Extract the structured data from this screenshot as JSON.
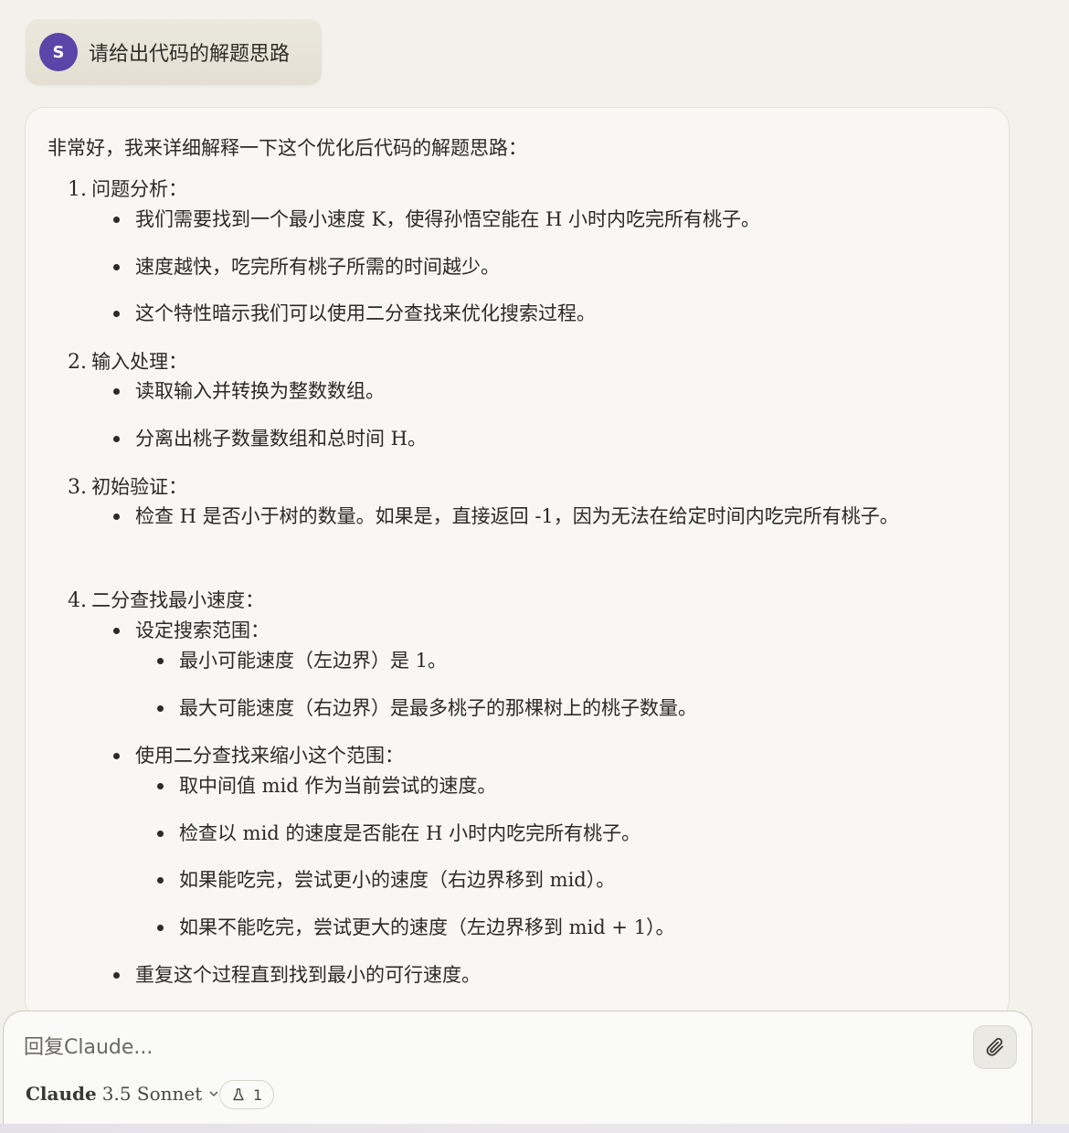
{
  "user_message": {
    "avatar_letter": "S",
    "text": "请给出代码的解题思路"
  },
  "assistant": {
    "intro": "非常好，我来详细解释一下这个优化后代码的解题思路：",
    "steps": [
      {
        "num": "1.",
        "title": "问题分析：",
        "bullets": [
          "我们需要找到一个最小速度 K，使得孙悟空能在 H 小时内吃完所有桃子。",
          "速度越快，吃完所有桃子所需的时间越少。",
          "这个特性暗示我们可以使用二分查找来优化搜索过程。"
        ]
      },
      {
        "num": "2.",
        "title": "输入处理：",
        "bullets": [
          "读取输入并转换为整数数组。",
          "分离出桃子数量数组和总时间 H。"
        ]
      },
      {
        "num": "3.",
        "title": "初始验证：",
        "bullets": [
          "检查 H 是否小于树的数量。如果是，直接返回 -1，因为无法在给定时间内吃完所有桃子。"
        ]
      },
      {
        "num": "4.",
        "title": "二分查找最小速度：",
        "bullets": [
          {
            "text": "设定搜索范围：",
            "sub": [
              "最小可能速度（左边界）是 1。",
              "最大可能速度（右边界）是最多桃子的那棵树上的桃子数量。"
            ]
          },
          {
            "text": "使用二分查找来缩小这个范围：",
            "sub": [
              "取中间值 mid 作为当前尝试的速度。",
              "检查以 mid 的速度是否能在 H 小时内吃完所有桃子。",
              "如果能吃完，尝试更小的速度（右边界移到 mid）。",
              "如果不能吃完，尝试更大的速度（左边界移到 mid + 1）。"
            ]
          },
          {
            "text": "重复这个过程直到找到最小的可行速度。"
          }
        ]
      }
    ]
  },
  "composer": {
    "placeholder": "回复Claude...",
    "model_name": "Claude",
    "model_version": "3.5 Sonnet",
    "badge_count": "1",
    "attach_icon": "paperclip-icon",
    "badge_icon": "flask-icon"
  },
  "colors": {
    "avatar": "#5b45a8",
    "background": "#f3f1ec",
    "card": "#f8f7f4"
  }
}
